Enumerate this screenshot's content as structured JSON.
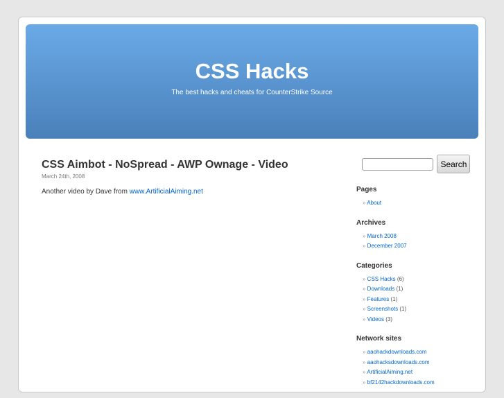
{
  "header": {
    "title": "CSS Hacks",
    "description": "The best hacks and cheats for CounterStrike Source"
  },
  "post": {
    "title": "CSS Aimbot - NoSpread - AWP Ownage - Video",
    "date": "March 24th, 2008",
    "body_text": "Another video by Dave from ",
    "link": "www.ArtificialAiming.net"
  },
  "search": {
    "value": "",
    "button": "Search"
  },
  "sidebar": {
    "pages": {
      "title": "Pages",
      "items": [
        {
          "label": "About"
        }
      ]
    },
    "archives": {
      "title": "Archives",
      "items": [
        {
          "label": "March 2008"
        },
        {
          "label": "December 2007"
        }
      ]
    },
    "categories": {
      "title": "Categories",
      "items": [
        {
          "label": "CSS Hacks",
          "count": "(6)"
        },
        {
          "label": "Downloads",
          "count": "(1)"
        },
        {
          "label": "Features",
          "count": "(1)"
        },
        {
          "label": "Screenshots",
          "count": "(1)"
        },
        {
          "label": "Videos",
          "count": "(3)"
        }
      ]
    },
    "network": {
      "title": "Network sites",
      "items": [
        {
          "label": "aaohackdownloads.com"
        },
        {
          "label": "aaohacksdownloads.com"
        },
        {
          "label": "ArtificialAiming.net"
        },
        {
          "label": "bf2142hackdownloads.com"
        }
      ]
    }
  }
}
